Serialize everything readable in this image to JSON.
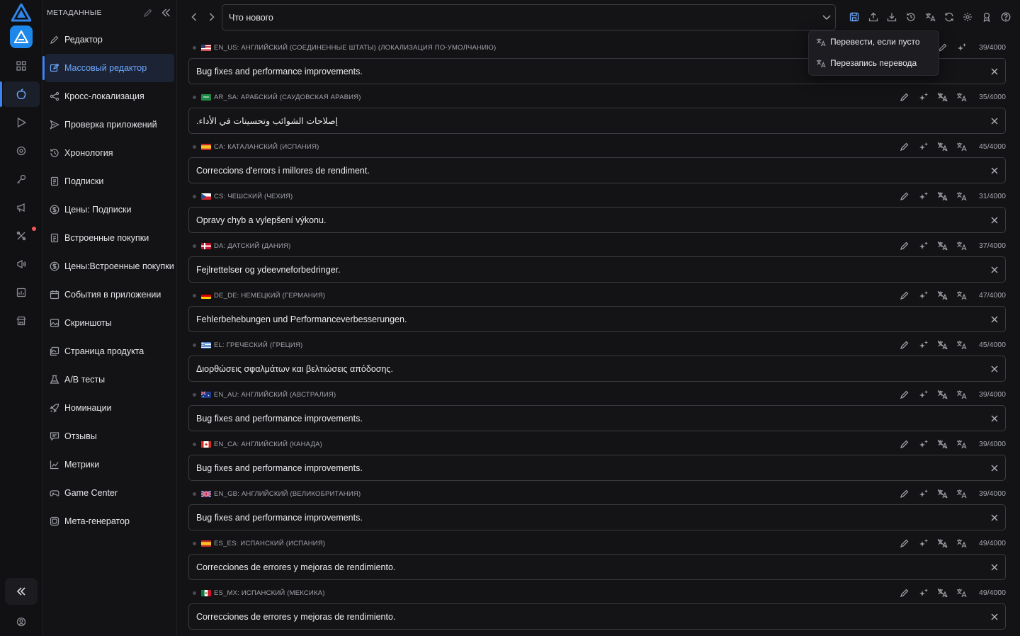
{
  "sidebar": {
    "title": "МЕТАДАННЫЕ",
    "items": [
      {
        "label": "Редактор",
        "icon": "pencil-icon"
      },
      {
        "label": "Массовый редактор",
        "icon": "bulk-edit-icon",
        "active": true
      },
      {
        "label": "Кросс-локализация",
        "icon": "share-icon"
      },
      {
        "label": "Проверка приложений",
        "icon": "send-icon"
      },
      {
        "label": "Хронология",
        "icon": "history-icon"
      },
      {
        "label": "Подписки",
        "icon": "document-icon"
      },
      {
        "label": "Цены: Подписки",
        "icon": "dollar-icon"
      },
      {
        "label": "Встроенные покупки",
        "icon": "document-icon"
      },
      {
        "label": "Цены:Встроенные покупки",
        "icon": "dollar-icon"
      },
      {
        "label": "События в приложении",
        "icon": "calendar-icon"
      },
      {
        "label": "Скриншоты",
        "icon": "image-icon"
      },
      {
        "label": "Страница продукта",
        "icon": "gallery-icon"
      },
      {
        "label": "A/B тесты",
        "icon": "flask-icon"
      },
      {
        "label": "Номинации",
        "icon": "rocket-icon"
      },
      {
        "label": "Отзывы",
        "icon": "comment-icon"
      },
      {
        "label": "Метрики",
        "icon": "chart-icon"
      },
      {
        "label": "Game Center",
        "icon": "gamepad-icon"
      },
      {
        "label": "Мета-генератор",
        "icon": "box-icon"
      }
    ]
  },
  "topbar": {
    "field_selected": "Что нового"
  },
  "dropdown": {
    "items": [
      "Перевести, если пусто",
      "Перезапись перевода"
    ]
  },
  "locales": [
    {
      "code": "EN_US: АНГЛИЙСКИЙ (СОЕДИНЕННЫЕ ШТАТЫ) (ЛОКАЛИЗАЦИЯ ПО-УМОЛЧАНИЮ)",
      "flag": "us",
      "text": "Bug fixes and performance improvements.",
      "count": "39/4000"
    },
    {
      "code": "AR_SA: АРАБСКИЙ (САУДОВСКАЯ АРАВИЯ)",
      "flag": "sa",
      "text": "إصلاحات الشوائب وتحسينات في الأداء.",
      "count": "35/4000"
    },
    {
      "code": "CA: КАТАЛАНСКИЙ (ИСПАНИЯ)",
      "flag": "es",
      "text": "Correccions d'errors i millores de rendiment.",
      "count": "45/4000"
    },
    {
      "code": "CS: ЧЕШСКИЙ (ЧЕХИЯ)",
      "flag": "cz",
      "text": "Opravy chyb a vylepšení výkonu.",
      "count": "31/4000"
    },
    {
      "code": "DA: ДАТСКИЙ (ДАНИЯ)",
      "flag": "dk",
      "text": "Fejlrettelser og ydeevneforbedringer.",
      "count": "37/4000"
    },
    {
      "code": "DE_DE: НЕМЕЦКИЙ (ГЕРМАНИЯ)",
      "flag": "de",
      "text": "Fehlerbehebungen und Performanceverbesserungen.",
      "count": "47/4000"
    },
    {
      "code": "EL: ГРЕЧЕСКИЙ (ГРЕЦИЯ)",
      "flag": "gr",
      "text": "Διορθώσεις σφαλμάτων και βελτιώσεις απόδοσης.",
      "count": "45/4000"
    },
    {
      "code": "EN_AU: АНГЛИЙСКИЙ (АВСТРАЛИЯ)",
      "flag": "au",
      "text": "Bug fixes and performance improvements.",
      "count": "39/4000"
    },
    {
      "code": "EN_CA: АНГЛИЙСКИЙ (КАНАДА)",
      "flag": "ca",
      "text": "Bug fixes and performance improvements.",
      "count": "39/4000"
    },
    {
      "code": "EN_GB: АНГЛИЙСКИЙ (ВЕЛИКОБРИТАНИЯ)",
      "flag": "gb",
      "text": "Bug fixes and performance improvements.",
      "count": "39/4000"
    },
    {
      "code": "ES_ES: ИСПАНСКИЙ (ИСПАНИЯ)",
      "flag": "es",
      "text": "Correcciones de errores y mejoras de rendimiento.",
      "count": "49/4000"
    },
    {
      "code": "ES_MX: ИСПАНСКИЙ (МЕКСИКА)",
      "flag": "mx",
      "text": "Correcciones de errores y mejoras de rendimiento.",
      "count": "49/4000"
    }
  ],
  "colors": {
    "accent": "#3b82f6",
    "background": "#131315",
    "notification": "#f2555a"
  }
}
